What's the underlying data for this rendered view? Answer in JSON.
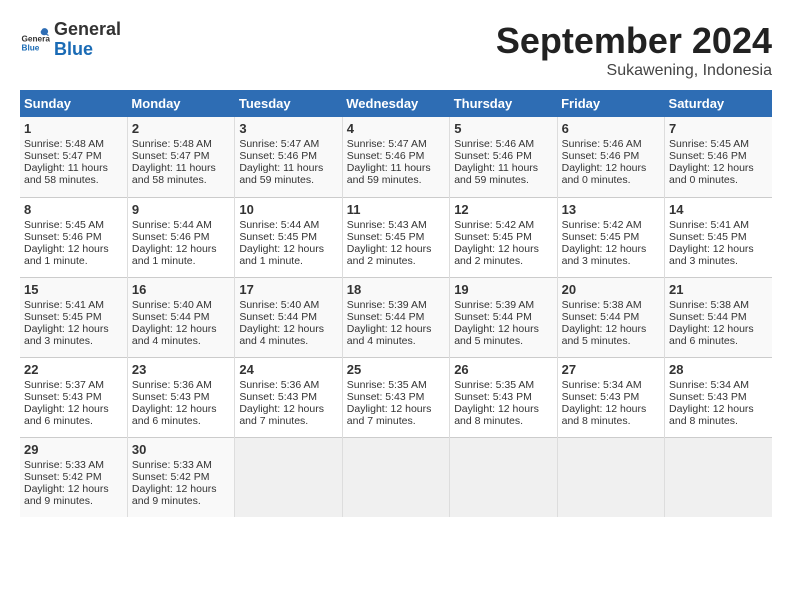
{
  "header": {
    "logo_general": "General",
    "logo_blue": "Blue",
    "month_title": "September 2024",
    "location": "Sukawening, Indonesia"
  },
  "days_of_week": [
    "Sunday",
    "Monday",
    "Tuesday",
    "Wednesday",
    "Thursday",
    "Friday",
    "Saturday"
  ],
  "weeks": [
    [
      {
        "day": "1",
        "sunrise": "Sunrise: 5:48 AM",
        "sunset": "Sunset: 5:47 PM",
        "daylight": "Daylight: 11 hours and 58 minutes."
      },
      {
        "day": "2",
        "sunrise": "Sunrise: 5:48 AM",
        "sunset": "Sunset: 5:47 PM",
        "daylight": "Daylight: 11 hours and 58 minutes."
      },
      {
        "day": "3",
        "sunrise": "Sunrise: 5:47 AM",
        "sunset": "Sunset: 5:46 PM",
        "daylight": "Daylight: 11 hours and 59 minutes."
      },
      {
        "day": "4",
        "sunrise": "Sunrise: 5:47 AM",
        "sunset": "Sunset: 5:46 PM",
        "daylight": "Daylight: 11 hours and 59 minutes."
      },
      {
        "day": "5",
        "sunrise": "Sunrise: 5:46 AM",
        "sunset": "Sunset: 5:46 PM",
        "daylight": "Daylight: 11 hours and 59 minutes."
      },
      {
        "day": "6",
        "sunrise": "Sunrise: 5:46 AM",
        "sunset": "Sunset: 5:46 PM",
        "daylight": "Daylight: 12 hours and 0 minutes."
      },
      {
        "day": "7",
        "sunrise": "Sunrise: 5:45 AM",
        "sunset": "Sunset: 5:46 PM",
        "daylight": "Daylight: 12 hours and 0 minutes."
      }
    ],
    [
      {
        "day": "8",
        "sunrise": "Sunrise: 5:45 AM",
        "sunset": "Sunset: 5:46 PM",
        "daylight": "Daylight: 12 hours and 1 minute."
      },
      {
        "day": "9",
        "sunrise": "Sunrise: 5:44 AM",
        "sunset": "Sunset: 5:46 PM",
        "daylight": "Daylight: 12 hours and 1 minute."
      },
      {
        "day": "10",
        "sunrise": "Sunrise: 5:44 AM",
        "sunset": "Sunset: 5:45 PM",
        "daylight": "Daylight: 12 hours and 1 minute."
      },
      {
        "day": "11",
        "sunrise": "Sunrise: 5:43 AM",
        "sunset": "Sunset: 5:45 PM",
        "daylight": "Daylight: 12 hours and 2 minutes."
      },
      {
        "day": "12",
        "sunrise": "Sunrise: 5:42 AM",
        "sunset": "Sunset: 5:45 PM",
        "daylight": "Daylight: 12 hours and 2 minutes."
      },
      {
        "day": "13",
        "sunrise": "Sunrise: 5:42 AM",
        "sunset": "Sunset: 5:45 PM",
        "daylight": "Daylight: 12 hours and 3 minutes."
      },
      {
        "day": "14",
        "sunrise": "Sunrise: 5:41 AM",
        "sunset": "Sunset: 5:45 PM",
        "daylight": "Daylight: 12 hours and 3 minutes."
      }
    ],
    [
      {
        "day": "15",
        "sunrise": "Sunrise: 5:41 AM",
        "sunset": "Sunset: 5:45 PM",
        "daylight": "Daylight: 12 hours and 3 minutes."
      },
      {
        "day": "16",
        "sunrise": "Sunrise: 5:40 AM",
        "sunset": "Sunset: 5:44 PM",
        "daylight": "Daylight: 12 hours and 4 minutes."
      },
      {
        "day": "17",
        "sunrise": "Sunrise: 5:40 AM",
        "sunset": "Sunset: 5:44 PM",
        "daylight": "Daylight: 12 hours and 4 minutes."
      },
      {
        "day": "18",
        "sunrise": "Sunrise: 5:39 AM",
        "sunset": "Sunset: 5:44 PM",
        "daylight": "Daylight: 12 hours and 4 minutes."
      },
      {
        "day": "19",
        "sunrise": "Sunrise: 5:39 AM",
        "sunset": "Sunset: 5:44 PM",
        "daylight": "Daylight: 12 hours and 5 minutes."
      },
      {
        "day": "20",
        "sunrise": "Sunrise: 5:38 AM",
        "sunset": "Sunset: 5:44 PM",
        "daylight": "Daylight: 12 hours and 5 minutes."
      },
      {
        "day": "21",
        "sunrise": "Sunrise: 5:38 AM",
        "sunset": "Sunset: 5:44 PM",
        "daylight": "Daylight: 12 hours and 6 minutes."
      }
    ],
    [
      {
        "day": "22",
        "sunrise": "Sunrise: 5:37 AM",
        "sunset": "Sunset: 5:43 PM",
        "daylight": "Daylight: 12 hours and 6 minutes."
      },
      {
        "day": "23",
        "sunrise": "Sunrise: 5:36 AM",
        "sunset": "Sunset: 5:43 PM",
        "daylight": "Daylight: 12 hours and 6 minutes."
      },
      {
        "day": "24",
        "sunrise": "Sunrise: 5:36 AM",
        "sunset": "Sunset: 5:43 PM",
        "daylight": "Daylight: 12 hours and 7 minutes."
      },
      {
        "day": "25",
        "sunrise": "Sunrise: 5:35 AM",
        "sunset": "Sunset: 5:43 PM",
        "daylight": "Daylight: 12 hours and 7 minutes."
      },
      {
        "day": "26",
        "sunrise": "Sunrise: 5:35 AM",
        "sunset": "Sunset: 5:43 PM",
        "daylight": "Daylight: 12 hours and 8 minutes."
      },
      {
        "day": "27",
        "sunrise": "Sunrise: 5:34 AM",
        "sunset": "Sunset: 5:43 PM",
        "daylight": "Daylight: 12 hours and 8 minutes."
      },
      {
        "day": "28",
        "sunrise": "Sunrise: 5:34 AM",
        "sunset": "Sunset: 5:43 PM",
        "daylight": "Daylight: 12 hours and 8 minutes."
      }
    ],
    [
      {
        "day": "29",
        "sunrise": "Sunrise: 5:33 AM",
        "sunset": "Sunset: 5:42 PM",
        "daylight": "Daylight: 12 hours and 9 minutes."
      },
      {
        "day": "30",
        "sunrise": "Sunrise: 5:33 AM",
        "sunset": "Sunset: 5:42 PM",
        "daylight": "Daylight: 12 hours and 9 minutes."
      },
      null,
      null,
      null,
      null,
      null
    ]
  ]
}
